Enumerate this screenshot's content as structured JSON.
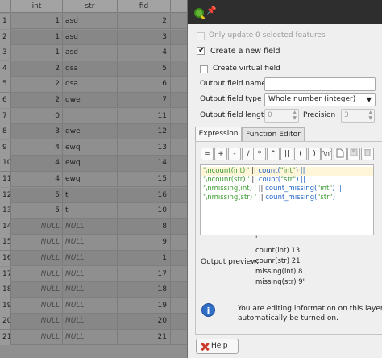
{
  "table": {
    "columns": [
      "int",
      "str",
      "fid"
    ],
    "rows": [
      {
        "n": "1",
        "int": "1",
        "str": "asd",
        "fid": "2",
        "null": false
      },
      {
        "n": "2",
        "int": "1",
        "str": "asd",
        "fid": "3",
        "null": false
      },
      {
        "n": "3",
        "int": "1",
        "str": "asd",
        "fid": "4",
        "null": false
      },
      {
        "n": "4",
        "int": "2",
        "str": "dsa",
        "fid": "5",
        "null": false
      },
      {
        "n": "5",
        "int": "2",
        "str": "dsa",
        "fid": "6",
        "null": false
      },
      {
        "n": "6",
        "int": "2",
        "str": "qwe",
        "fid": "7",
        "null": false
      },
      {
        "n": "7",
        "int": "0",
        "str": "",
        "fid": "11",
        "null": false
      },
      {
        "n": "8",
        "int": "3",
        "str": "qwe",
        "fid": "12",
        "null": false
      },
      {
        "n": "9",
        "int": "4",
        "str": "ewq",
        "fid": "13",
        "null": false
      },
      {
        "n": "10",
        "int": "4",
        "str": "ewq",
        "fid": "14",
        "null": false
      },
      {
        "n": "11",
        "int": "4",
        "str": "ewq",
        "fid": "15",
        "null": false
      },
      {
        "n": "12",
        "int": "5",
        "str": "t",
        "fid": "16",
        "null": false
      },
      {
        "n": "13",
        "int": "5",
        "str": "t",
        "fid": "10",
        "null": false
      },
      {
        "n": "14",
        "int": "NULL",
        "str": "NULL",
        "fid": "8",
        "null": true
      },
      {
        "n": "15",
        "int": "NULL",
        "str": "NULL",
        "fid": "9",
        "null": true
      },
      {
        "n": "16",
        "int": "NULL",
        "str": "NULL",
        "fid": "1",
        "null": true
      },
      {
        "n": "17",
        "int": "NULL",
        "str": "NULL",
        "fid": "17",
        "null": true
      },
      {
        "n": "18",
        "int": "NULL",
        "str": "NULL",
        "fid": "18",
        "null": true
      },
      {
        "n": "19",
        "int": "NULL",
        "str": "NULL",
        "fid": "19",
        "null": true
      },
      {
        "n": "20",
        "int": "NULL",
        "str": "NULL",
        "fid": "20",
        "null": true
      },
      {
        "n": "21",
        "int": "NULL",
        "str": "NULL",
        "fid": "21",
        "null": true
      }
    ]
  },
  "panel": {
    "only_update_label": "Only update 0 selected features",
    "create_new_field_label": "Create a new field",
    "create_virtual_label": "Create virtual field",
    "output_field_name_label": "Output field name",
    "output_field_name_value": "",
    "output_field_type_label": "Output field type",
    "output_field_type_value": "Whole number (integer)",
    "output_field_length_label": "Output field length",
    "output_field_length_value": "0",
    "precision_label": "Precision",
    "precision_value": "3",
    "tabs": [
      "Expression",
      "Function Editor"
    ],
    "toolbar": [
      "=",
      "+",
      "-",
      "/",
      "*",
      "^",
      "||",
      "(",
      ")",
      "'\\n'"
    ],
    "expression_lines": [
      {
        "s1": "'\\ncount(int) '",
        "op": " || ",
        "f": "count(",
        "arg": "\"int\"",
        "close": ") ||"
      },
      {
        "s1": "'\\ncounr(str) '",
        "op": " || ",
        "f": "count(",
        "arg": "\"str\"",
        "close": ") ||"
      },
      {
        "s1": "'\\nmissing(int) '",
        "op": " || ",
        "f": "count_missing(",
        "arg": "\"int\"",
        "close": ") ||"
      },
      {
        "s1": "'\\nmissing(str) '",
        "op": " || ",
        "f": "count_missing(",
        "arg": "\"str\"",
        "close": ")"
      }
    ],
    "output_preview_label": "Output preview:",
    "output_preview_lines": [
      "'",
      "count(int) 13",
      "counr(str) 21",
      "missing(int) 8",
      "missing(str) 9'"
    ],
    "info_line1": "You are editing information on this layer but",
    "info_line2": "automatically be turned on.",
    "help_label": "Help"
  },
  "colors": {
    "table_bg": "#8f8f8f",
    "panel_bg": "#efefef",
    "titlebar": "#2e2e2e",
    "string": "#3a9a2e",
    "function": "#2366c9",
    "info": "#2f6fc6"
  }
}
